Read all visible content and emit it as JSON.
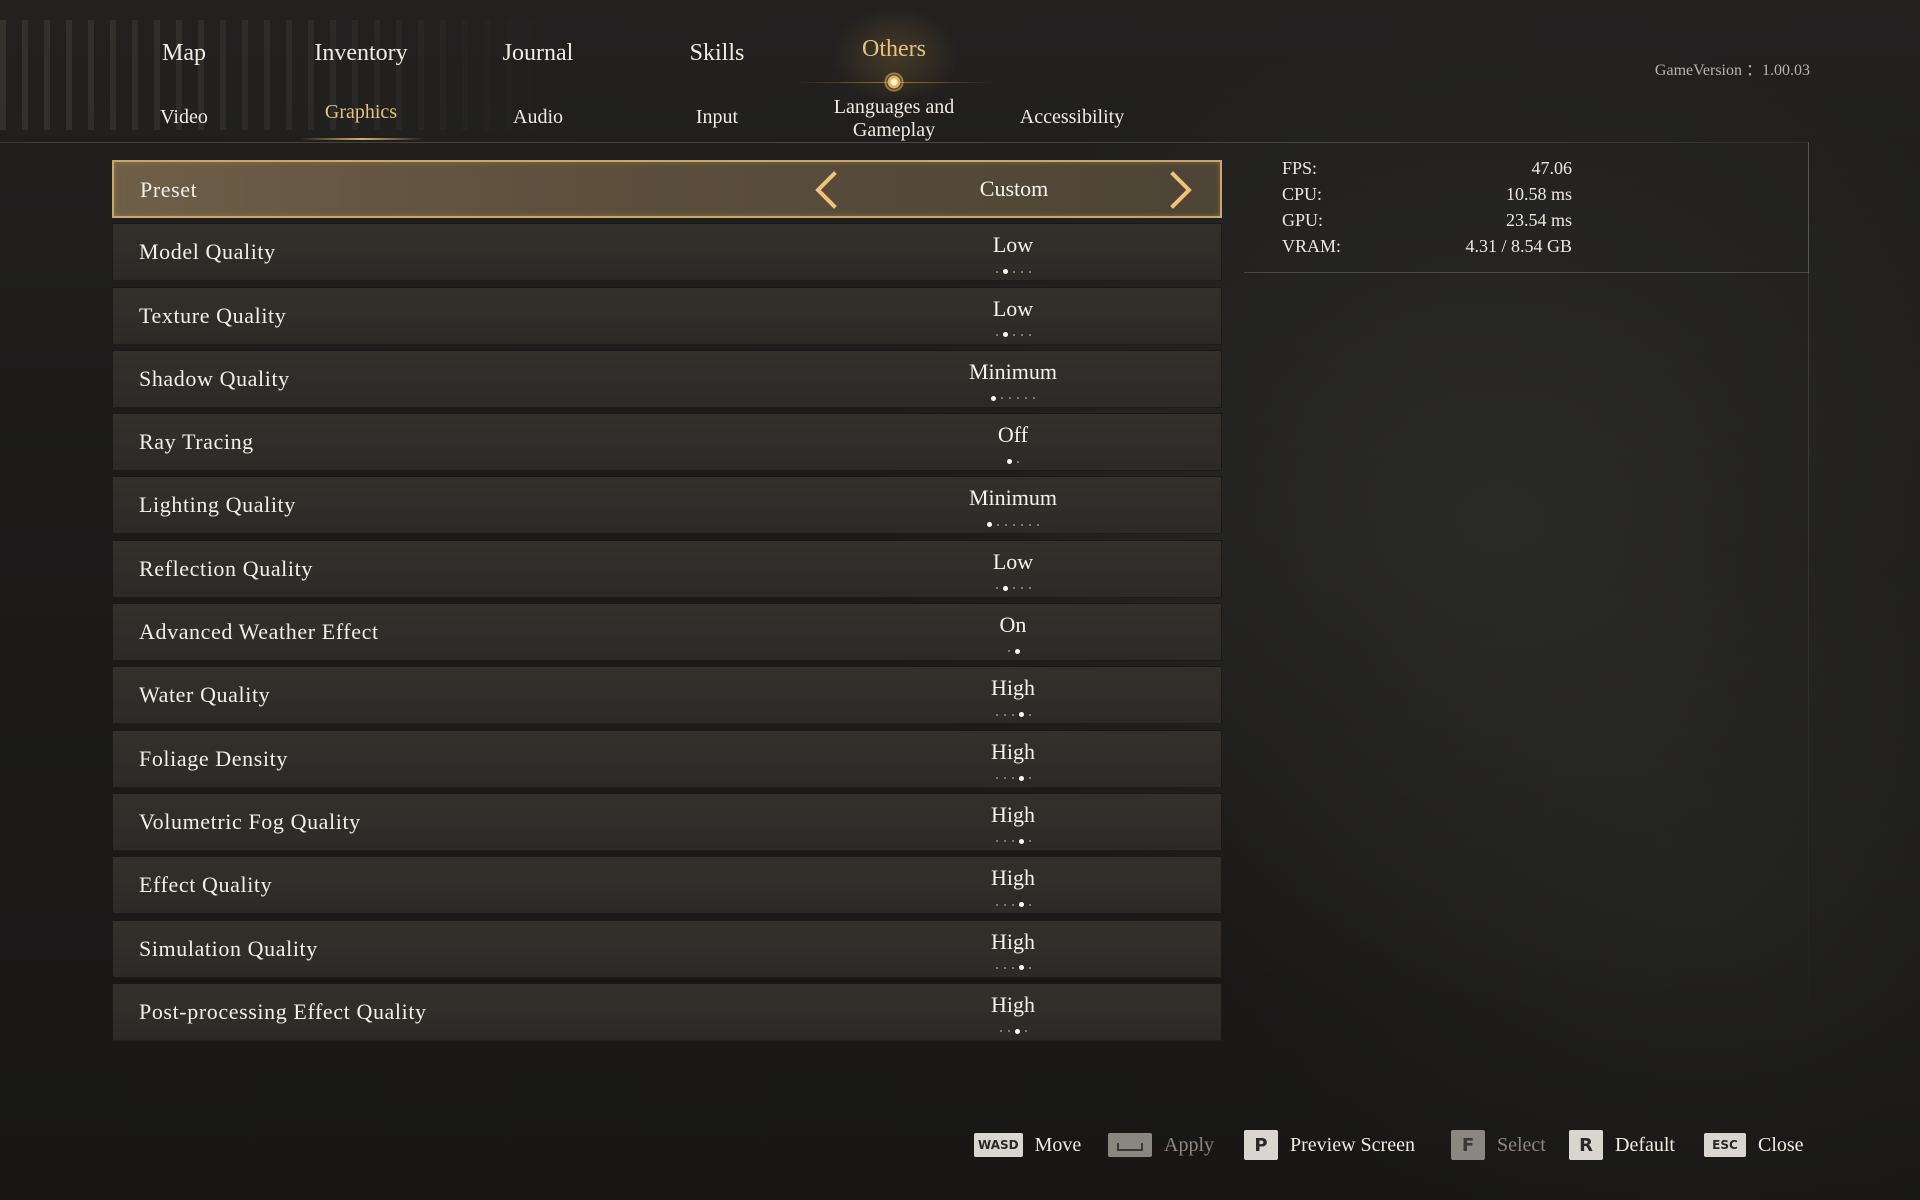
{
  "nav": {
    "main_tabs": [
      {
        "label": "Map"
      },
      {
        "label": "Inventory"
      },
      {
        "label": "Journal"
      },
      {
        "label": "Skills"
      },
      {
        "label": "Others"
      }
    ],
    "active_main_tab": "Others",
    "sub_tabs": [
      {
        "label": "Video"
      },
      {
        "label": "Graphics"
      },
      {
        "label": "Audio"
      },
      {
        "label": "Input"
      },
      {
        "label_line1": "Languages and",
        "label_line2": "Gameplay"
      },
      {
        "label": "Accessibility"
      }
    ],
    "active_sub_tab": "Graphics"
  },
  "game_version": "GameVersion ：1.00.03",
  "settings": {
    "preset": {
      "label": "Preset",
      "value": "Custom"
    },
    "rows": [
      {
        "label": "Model Quality",
        "value": "Low",
        "levels": 5,
        "selected": 1
      },
      {
        "label": "Texture Quality",
        "value": "Low",
        "levels": 5,
        "selected": 1
      },
      {
        "label": "Shadow Quality",
        "value": "Minimum",
        "levels": 6,
        "selected": 0
      },
      {
        "label": "Ray Tracing",
        "value": "Off",
        "levels": 2,
        "selected": 0
      },
      {
        "label": "Lighting Quality",
        "value": "Minimum",
        "levels": 7,
        "selected": 0
      },
      {
        "label": "Reflection Quality",
        "value": "Low",
        "levels": 5,
        "selected": 1
      },
      {
        "label": "Advanced Weather Effect",
        "value": "On",
        "levels": 2,
        "selected": 1
      },
      {
        "label": "Water Quality",
        "value": "High",
        "levels": 5,
        "selected": 3
      },
      {
        "label": "Foliage Density",
        "value": "High",
        "levels": 5,
        "selected": 3
      },
      {
        "label": "Volumetric Fog Quality",
        "value": "High",
        "levels": 5,
        "selected": 3
      },
      {
        "label": "Effect Quality",
        "value": "High",
        "levels": 5,
        "selected": 3
      },
      {
        "label": "Simulation Quality",
        "value": "High",
        "levels": 5,
        "selected": 3
      },
      {
        "label": "Post-processing Effect Quality",
        "value": "High",
        "levels": 4,
        "selected": 2
      }
    ]
  },
  "stats": {
    "fps": {
      "label": "FPS:",
      "value": "47.06"
    },
    "cpu": {
      "label": "CPU:",
      "value": "10.58  ms"
    },
    "gpu": {
      "label": "GPU:",
      "value": "23.54  ms"
    },
    "vram": {
      "label": "VRAM:",
      "value": "4.31  /  8.54  GB"
    }
  },
  "footer": {
    "hints": [
      {
        "key": "WASD",
        "label": "Move",
        "icon": "wasd-key-icon",
        "dim": false
      },
      {
        "key": "",
        "label": "Apply",
        "icon": "space-key-icon",
        "dim": true
      },
      {
        "key": "P",
        "label": "Preview Screen",
        "icon": "p-key-icon",
        "dim": false
      },
      {
        "key": "F",
        "label": "Select",
        "icon": "f-key-icon",
        "dim": true
      },
      {
        "key": "R",
        "label": "Default",
        "icon": "r-key-icon",
        "dim": false
      },
      {
        "key": "ESC",
        "label": "Close",
        "icon": "esc-key-icon",
        "dim": false
      }
    ]
  },
  "colors": {
    "accent_gold": "#e9c27a",
    "text": "#f0ece4",
    "row_bg": "#2f2c29",
    "preset_border": "#c9a66a"
  }
}
